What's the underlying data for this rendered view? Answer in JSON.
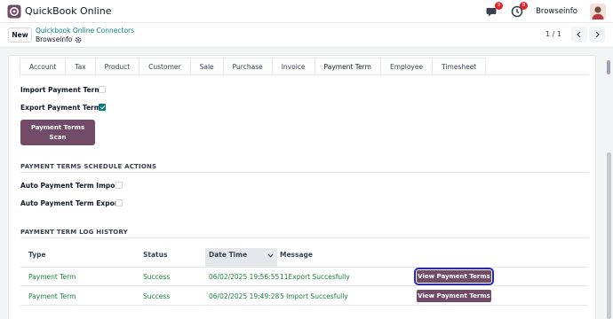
{
  "app": {
    "title": "QuickBook Online",
    "logo_icon": "app-grid-icon",
    "brand_color": "#714b67"
  },
  "navbar": {
    "messages_badge": "9",
    "activity_badge": "8",
    "company": "Browseinfo"
  },
  "control_panel": {
    "new_label": "New",
    "breadcrumb_parent": "Quickbook Online Connectors",
    "breadcrumb_current": "Browseinfo",
    "pager": "1 / 1"
  },
  "tabs": [
    {
      "label": "Account",
      "active": false
    },
    {
      "label": "Tax",
      "active": false
    },
    {
      "label": "Product",
      "active": false
    },
    {
      "label": "Customer",
      "active": false
    },
    {
      "label": "Sale",
      "active": false
    },
    {
      "label": "Purchase",
      "active": false
    },
    {
      "label": "Invoice",
      "active": false
    },
    {
      "label": "Payment Term",
      "active": true
    },
    {
      "label": "Employee",
      "active": false
    },
    {
      "label": "Timesheet",
      "active": false
    }
  ],
  "form": {
    "import_label": "Import Payment Term",
    "import_checked": false,
    "export_label": "Export Payment Term",
    "export_checked": true,
    "scan_button": "Payment Terms Scan",
    "schedule_title": "PAYMENT TERMS SCHEDULE ACTIONS",
    "auto_import_label": "Auto Payment Term Import",
    "auto_import_checked": false,
    "auto_export_label": "Auto Payment Term Export",
    "auto_export_checked": false,
    "log_title": "PAYMENT TERM LOG HISTORY"
  },
  "log_table": {
    "headers": {
      "type": "Type",
      "status": "Status",
      "date_time": "Date Time",
      "message": "Message"
    },
    "rows": [
      {
        "type": "Payment Term",
        "status": "Success",
        "date_time": "06/02/2025 19:56:55",
        "message": "11Export Succesfully",
        "action": "View Payment Terms"
      },
      {
        "type": "Payment Term",
        "status": "Success",
        "date_time": "06/02/2025 19:49:28",
        "message": "5 Import Succesfully",
        "action": "View Payment Terms"
      }
    ]
  }
}
